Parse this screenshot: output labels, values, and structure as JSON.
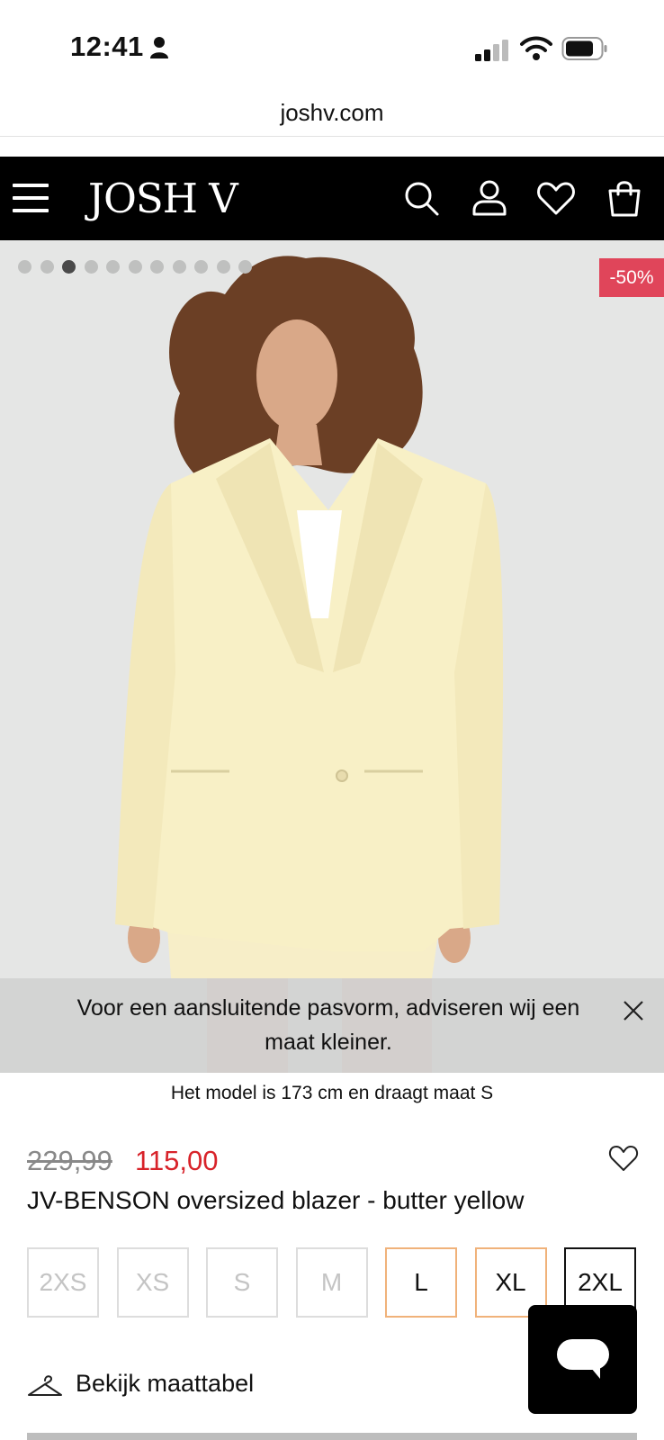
{
  "status": {
    "time": "12:41"
  },
  "browser": {
    "url": "joshv.com"
  },
  "header": {
    "logo": "JOSH V"
  },
  "gallery": {
    "dot_count": 11,
    "active_index": 2,
    "discount_badge": "-50%"
  },
  "fit_notice": {
    "text": "Voor een aansluitende pasvorm, adviseren wij een maat kleiner."
  },
  "model_note": "Het model is 173 cm en draagt maat S",
  "product": {
    "old_price": "229,99",
    "price": "115,00",
    "name": "JV-BENSON oversized blazer - butter yellow"
  },
  "sizes": [
    {
      "label": "2XS",
      "state": "unavailable"
    },
    {
      "label": "XS",
      "state": "unavailable"
    },
    {
      "label": "S",
      "state": "unavailable"
    },
    {
      "label": "M",
      "state": "unavailable"
    },
    {
      "label": "L",
      "state": "available"
    },
    {
      "label": "XL",
      "state": "available"
    },
    {
      "label": "2XL",
      "state": "selected"
    }
  ],
  "size_guide": {
    "label": "Bekijk maattabel"
  },
  "colors": {
    "accent_red": "#d8232a",
    "badge": "#e0455a",
    "available_border": "#f0b27a",
    "header_bg": "#000000",
    "hero_bg": "#e5e6e5"
  }
}
